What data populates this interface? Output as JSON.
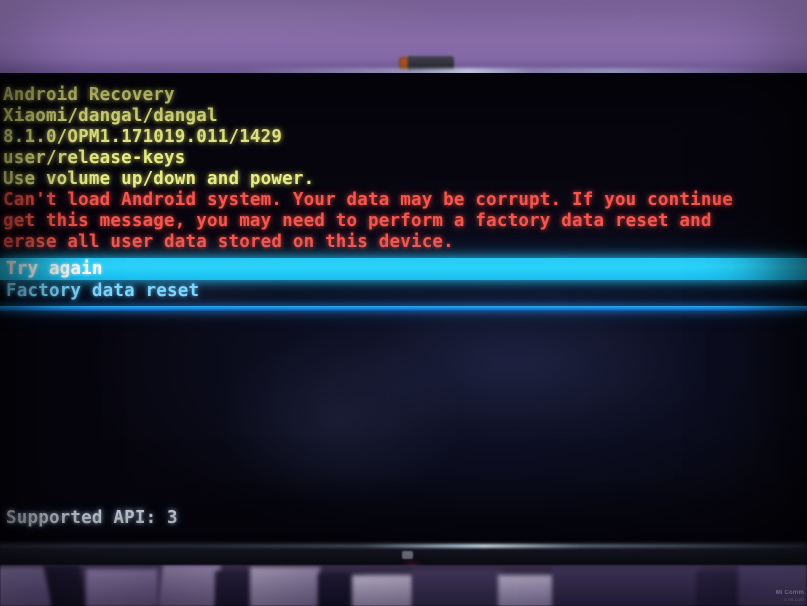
{
  "scene": {
    "description": "photo-of-monitor-showing-android-recovery",
    "wall_color": "#9e7fc4",
    "screen_bg": "#0a0c1e",
    "bezel_color": "#0f0f1a",
    "power_led_color": "#ff1f55"
  },
  "recovery": {
    "header": {
      "title": "Android Recovery",
      "device": "Xiaomi/dangal/dangal",
      "build": "8.1.0/OPM1.171019.011/1429",
      "keys": "user/release-keys",
      "instructions": "Use volume up/down and power.",
      "color": "#e9ec86"
    },
    "warning": {
      "color": "#f4564e",
      "lines": [
        "Can't load Android system. Your data may be corrupt. If you continue",
        "get this message, you may need to perform a factory data reset and",
        "erase all user data stored on this device."
      ]
    },
    "menu": {
      "selected_index": 0,
      "highlight_color": "#2ad3fb",
      "item_color": "#79d8ff",
      "selected_text_color": "#ffffff",
      "items": [
        {
          "label": "Try again",
          "selected": true
        },
        {
          "label": "Factory data reset",
          "selected": false
        }
      ]
    },
    "divider_color": "#1d86d8",
    "status": {
      "text": "Supported API: 3",
      "color": "#eef4ff"
    }
  },
  "watermark": {
    "line1": "Mi Comm",
    "line2": "o mi.com"
  }
}
